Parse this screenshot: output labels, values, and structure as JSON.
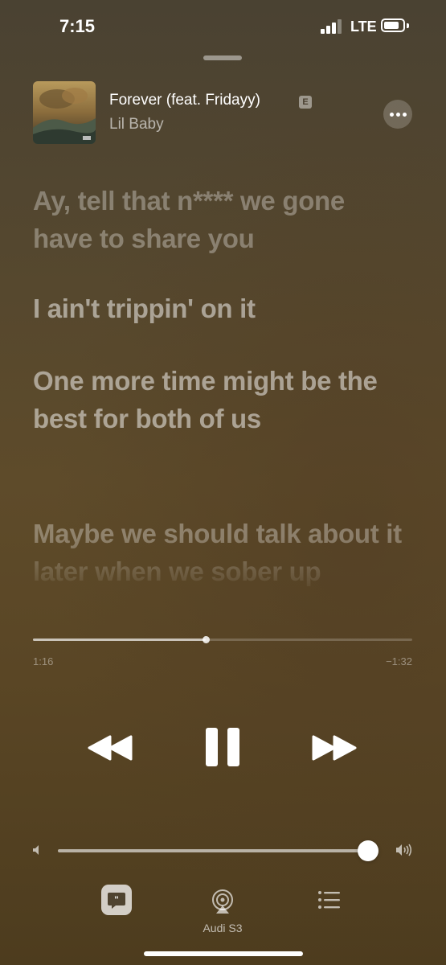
{
  "status_bar": {
    "time": "7:15",
    "network": "LTE",
    "signal_icon": "cellular-signal-icon",
    "battery_icon": "battery-icon"
  },
  "track": {
    "title": "Forever (feat. Fridayy)",
    "explicit_badge": "E",
    "artist": "Lil Baby",
    "more_icon": "ellipsis-icon"
  },
  "lyrics": [
    {
      "text": "Ay, tell that n**** we gone have to share you",
      "state": "past"
    },
    {
      "text": "I ain't trippin' on it",
      "state": "current"
    },
    {
      "text": "One more time might be the best for both of us",
      "state": "current"
    },
    {
      "text": "Maybe we should talk about it later when we sober up",
      "state": "upcoming"
    }
  ],
  "playback": {
    "elapsed": "1:16",
    "remaining": "−1:32",
    "progress_fraction": 0.456
  },
  "controls": {
    "previous_icon": "rewind-icon",
    "pause_icon": "pause-icon",
    "next_icon": "fast-forward-icon"
  },
  "volume": {
    "level_fraction": 0.99,
    "low_icon": "speaker-low-icon",
    "high_icon": "speaker-high-icon"
  },
  "bottom_bar": {
    "lyrics_icon": "quote-bubble-icon",
    "airplay_icon": "airplay-icon",
    "airplay_label": "Audi S3",
    "queue_icon": "list-icon"
  },
  "colors": {
    "background_top": "#4a4232",
    "background_bottom": "#4d3c1e",
    "accent": "#ffffff"
  }
}
